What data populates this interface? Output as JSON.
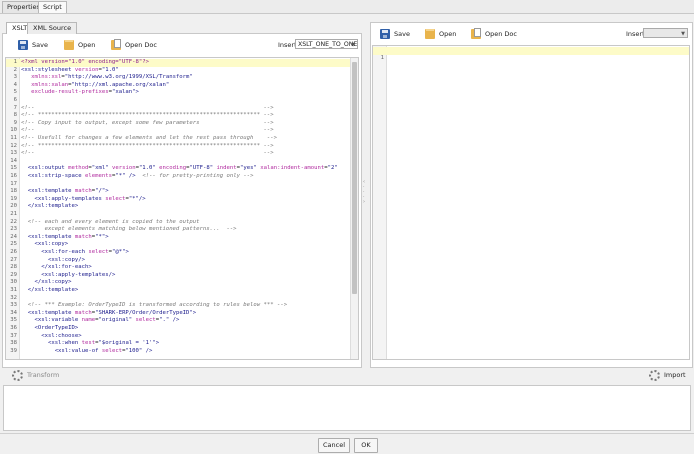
{
  "top_tabs": [
    "Properties",
    "Script"
  ],
  "left": {
    "sub_tabs": [
      "XSLT",
      "XML Source"
    ],
    "toolbar": {
      "save": "Save",
      "open": "Open",
      "open_doc": "Open Doc",
      "insert_label": "Insert",
      "insert_value": "XSLT_ONE_TO_ONE"
    },
    "lines": [
      [
        [
          "decl",
          "<?xml version=\"1.0\" encoding=\"UTF-8\"?>"
        ]
      ],
      [
        [
          "el",
          "<xsl:stylesheet "
        ],
        [
          "at",
          "version"
        ],
        [
          "pl",
          "="
        ],
        [
          "val",
          "\"1.0\""
        ]
      ],
      [
        [
          "pl",
          "   "
        ],
        [
          "at",
          "xmlns:xsl"
        ],
        [
          "pl",
          "="
        ],
        [
          "val",
          "\"http://www.w3.org/1999/XSL/Transform\""
        ]
      ],
      [
        [
          "pl",
          "   "
        ],
        [
          "at",
          "xmlns:xalan"
        ],
        [
          "pl",
          "="
        ],
        [
          "val",
          "\"http://xml.apache.org/xalan\""
        ]
      ],
      [
        [
          "pl",
          "   "
        ],
        [
          "at",
          "exclude-result-prefixes"
        ],
        [
          "pl",
          "="
        ],
        [
          "val",
          "\"xalan\">"
        ]
      ],
      [],
      [
        [
          "cm",
          "<!--                                                                    -->"
        ]
      ],
      [
        [
          "cm",
          "<!-- ****************************************************************** -->"
        ]
      ],
      [
        [
          "cm",
          "<!-- Copy input to output, except some few parameters                   -->"
        ]
      ],
      [
        [
          "cm",
          "<!--                                                                    -->"
        ]
      ],
      [
        [
          "cm",
          "<!-- Usefull for changes a few elements and let the rest pass through    -->"
        ]
      ],
      [
        [
          "cm",
          "<!-- ****************************************************************** -->"
        ]
      ],
      [
        [
          "cm",
          "<!--                                                                    -->"
        ]
      ],
      [],
      [
        [
          "pl",
          "  "
        ],
        [
          "el",
          "<xsl:output "
        ],
        [
          "at",
          "method"
        ],
        [
          "pl",
          "="
        ],
        [
          "val",
          "\"xml\" "
        ],
        [
          "at",
          "version"
        ],
        [
          "pl",
          "="
        ],
        [
          "val",
          "\"1.0\" "
        ],
        [
          "at",
          "encoding"
        ],
        [
          "pl",
          "="
        ],
        [
          "val",
          "\"UTF-8\" "
        ],
        [
          "at",
          "indent"
        ],
        [
          "pl",
          "="
        ],
        [
          "val",
          "\"yes\" "
        ],
        [
          "at",
          "xalan:indent-amount"
        ],
        [
          "pl",
          "="
        ],
        [
          "val",
          "\"2\""
        ]
      ],
      [
        [
          "pl",
          "  "
        ],
        [
          "el",
          "<xsl:strip-space "
        ],
        [
          "at",
          "elements"
        ],
        [
          "pl",
          "="
        ],
        [
          "val",
          "\"*\" "
        ],
        [
          "el",
          "/>"
        ],
        [
          "pl",
          "  "
        ],
        [
          "cm",
          "<!-- for pretty-printing only -->"
        ]
      ],
      [],
      [
        [
          "pl",
          "  "
        ],
        [
          "el",
          "<xsl:template "
        ],
        [
          "at",
          "match"
        ],
        [
          "pl",
          "="
        ],
        [
          "val",
          "\"/\">"
        ]
      ],
      [
        [
          "pl",
          "    "
        ],
        [
          "el",
          "<xsl:apply-templates "
        ],
        [
          "at",
          "select"
        ],
        [
          "pl",
          "="
        ],
        [
          "val",
          "\"*\"/>"
        ]
      ],
      [
        [
          "pl",
          "  "
        ],
        [
          "el",
          "</xsl:template>"
        ]
      ],
      [],
      [
        [
          "pl",
          "  "
        ],
        [
          "cm",
          "<!-- each and every element is copied to the output"
        ]
      ],
      [
        [
          "pl",
          "  "
        ],
        [
          "cm",
          "     except elements matching below mentioned patterns...  -->"
        ]
      ],
      [
        [
          "pl",
          "  "
        ],
        [
          "el",
          "<xsl:template "
        ],
        [
          "at",
          "match"
        ],
        [
          "pl",
          "="
        ],
        [
          "val",
          "\"*\">"
        ]
      ],
      [
        [
          "pl",
          "    "
        ],
        [
          "el",
          "<xsl:copy>"
        ]
      ],
      [
        [
          "pl",
          "      "
        ],
        [
          "el",
          "<xsl:for-each "
        ],
        [
          "at",
          "select"
        ],
        [
          "pl",
          "="
        ],
        [
          "val",
          "\"@*\">"
        ]
      ],
      [
        [
          "pl",
          "        "
        ],
        [
          "el",
          "<xsl:copy/>"
        ]
      ],
      [
        [
          "pl",
          "      "
        ],
        [
          "el",
          "</xsl:for-each>"
        ]
      ],
      [
        [
          "pl",
          "      "
        ],
        [
          "el",
          "<xsl:apply-templates/>"
        ]
      ],
      [
        [
          "pl",
          "    "
        ],
        [
          "el",
          "</xsl:copy>"
        ]
      ],
      [
        [
          "pl",
          "  "
        ],
        [
          "el",
          "</xsl:template>"
        ]
      ],
      [],
      [
        [
          "pl",
          "  "
        ],
        [
          "cm",
          "<!-- *** Example: OrderTypeID is transformed according to rules below *** -->"
        ]
      ],
      [
        [
          "pl",
          "  "
        ],
        [
          "el",
          "<xsl:template "
        ],
        [
          "at",
          "match"
        ],
        [
          "pl",
          "="
        ],
        [
          "val",
          "\"SHARK-ERP/Order/OrderTypeID\">"
        ]
      ],
      [
        [
          "pl",
          "    "
        ],
        [
          "el",
          "<xsl:variable "
        ],
        [
          "at",
          "name"
        ],
        [
          "pl",
          "="
        ],
        [
          "val",
          "\"original\" "
        ],
        [
          "at",
          "select"
        ],
        [
          "pl",
          "="
        ],
        [
          "val",
          "\".\" "
        ],
        [
          "el",
          "/>"
        ]
      ],
      [
        [
          "pl",
          "    "
        ],
        [
          "el",
          "<OrderTypeID>"
        ]
      ],
      [
        [
          "pl",
          "      "
        ],
        [
          "el",
          "<xsl:choose>"
        ]
      ],
      [
        [
          "pl",
          "        "
        ],
        [
          "el",
          "<xsl:when "
        ],
        [
          "at",
          "test"
        ],
        [
          "pl",
          "="
        ],
        [
          "val",
          "\"$original = '1'\">"
        ]
      ],
      [
        [
          "pl",
          "          "
        ],
        [
          "el",
          "<xsl:value-of "
        ],
        [
          "at",
          "select"
        ],
        [
          "pl",
          "="
        ],
        [
          "val",
          "\"100\" "
        ],
        [
          "el",
          "/>"
        ]
      ]
    ]
  },
  "right": {
    "toolbar": {
      "save": "Save",
      "open": "Open",
      "open_doc": "Open Doc",
      "insert_label": "Insert",
      "insert_value": ""
    },
    "first_line_number": "1"
  },
  "actions": {
    "transform": "Transform",
    "import": "Import"
  },
  "footer": {
    "cancel": "Cancel",
    "ok": "OK"
  }
}
